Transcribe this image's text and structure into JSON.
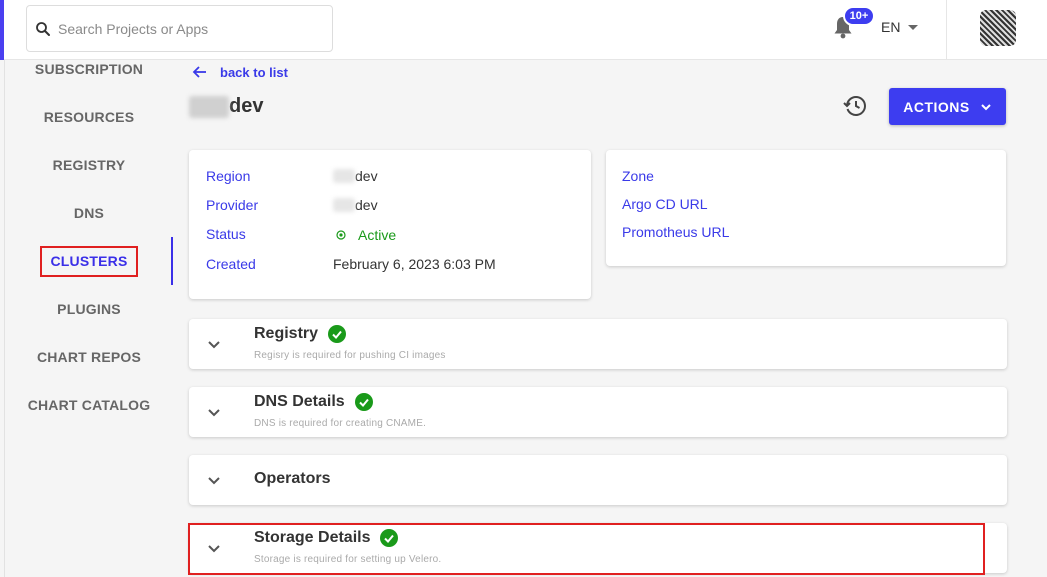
{
  "search": {
    "placeholder": "Search Projects or Apps"
  },
  "header": {
    "notification_count": "10+",
    "language": "EN"
  },
  "sidebar": {
    "items": [
      {
        "label": "SUBSCRIPTION"
      },
      {
        "label": "RESOURCES"
      },
      {
        "label": "REGISTRY"
      },
      {
        "label": "DNS"
      },
      {
        "label": "CLUSTERS",
        "active": true
      },
      {
        "label": "PLUGINS"
      },
      {
        "label": "CHART REPOS"
      },
      {
        "label": "CHART CATALOG"
      }
    ]
  },
  "main": {
    "back_label": "back to list",
    "title": "dev",
    "actions_label": "ACTIONS",
    "details": {
      "region_label": "Region",
      "region_value": "dev",
      "provider_label": "Provider",
      "provider_value": "dev",
      "status_label": "Status",
      "status_value": "Active",
      "created_label": "Created",
      "created_value": "February 6, 2023 6:03 PM"
    },
    "links": {
      "zone_label": "Zone",
      "argo_label": "Argo CD URL",
      "prometheus_label": "Promotheus URL"
    },
    "accordions": [
      {
        "title": "Registry",
        "subtitle": "Regisry is required for pushing CI images",
        "ok": true
      },
      {
        "title": "DNS Details",
        "subtitle": "DNS is required for creating CNAME.",
        "ok": true
      },
      {
        "title": "Operators",
        "subtitle": "",
        "ok": false
      },
      {
        "title": "Storage Details",
        "subtitle": "Storage is required for setting up Velero.",
        "ok": true
      }
    ]
  },
  "colors": {
    "accent": "#3d3df0",
    "success": "#1a9a1a",
    "highlight": "#e02020"
  }
}
